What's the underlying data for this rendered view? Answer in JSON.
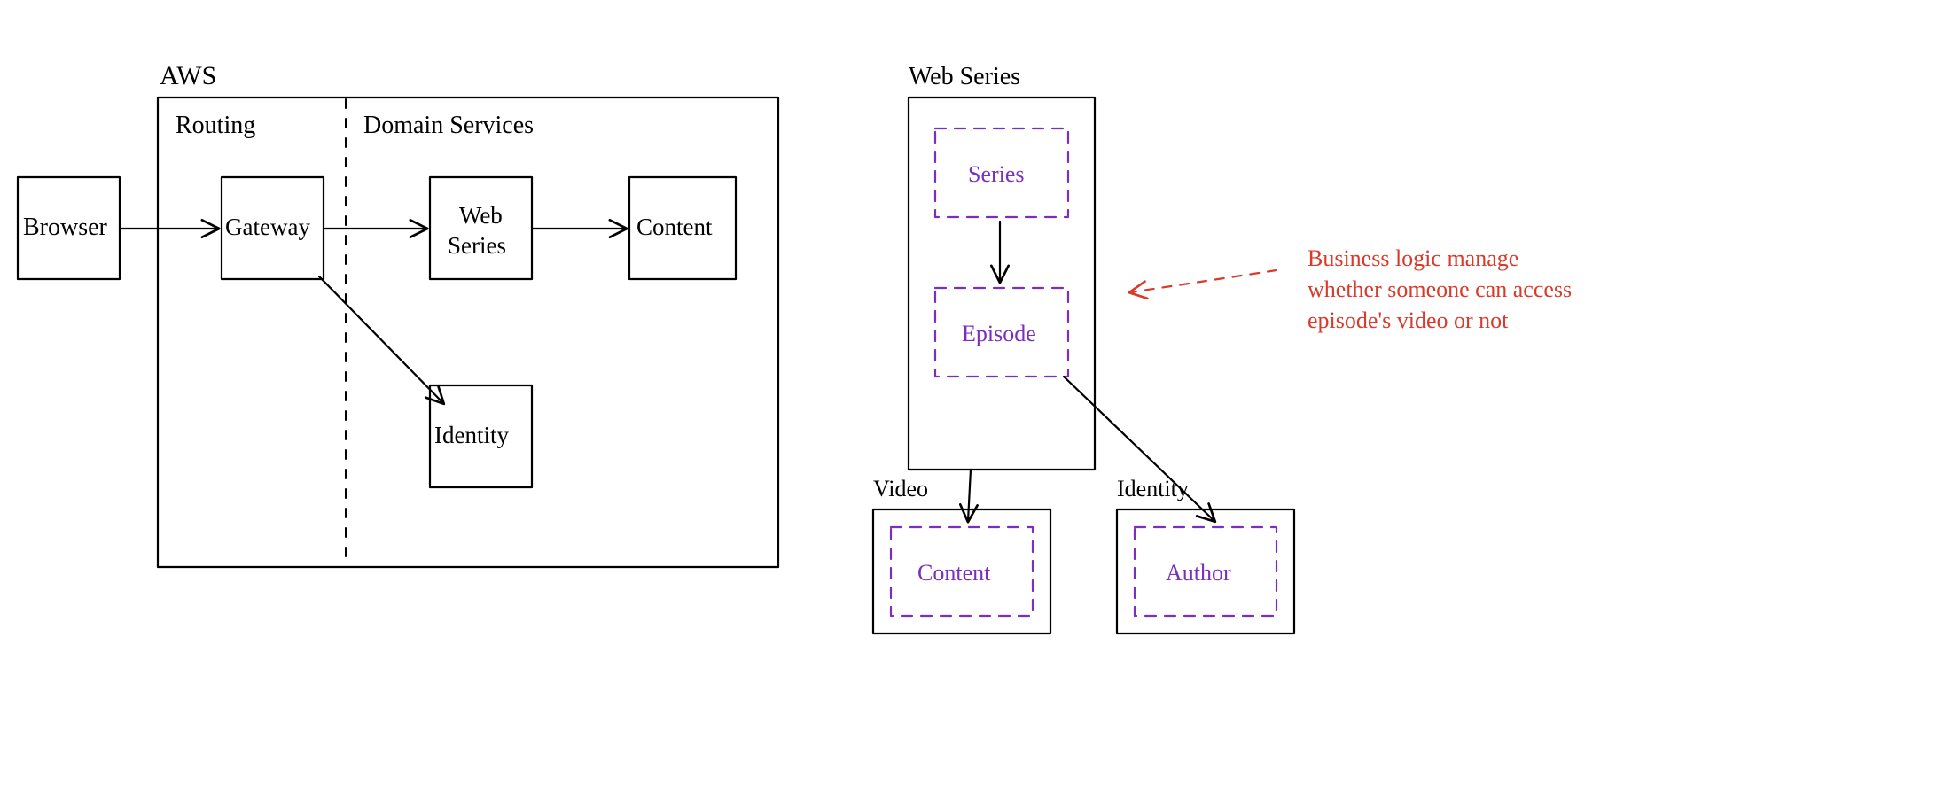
{
  "left": {
    "browser_label": "Browser",
    "aws_label": "AWS",
    "routing_label": "Routing",
    "domain_services_label": "Domain Services",
    "gateway_label": "Gateway",
    "web_series_line1": "Web",
    "web_series_line2": "Series",
    "content_label": "Content",
    "identity_label": "Identity"
  },
  "right": {
    "web_series_label": "Web Series",
    "series_label": "Series",
    "episode_label": "Episode",
    "video_label": "Video",
    "identity_label": "Identity",
    "content_label": "Content",
    "author_label": "Author",
    "note_line1": "Business logic manage",
    "note_line2": "whether someone can access",
    "note_line3": "episode's video or not"
  },
  "colors": {
    "purple": "#7b2fbf",
    "red": "#d93a2b",
    "black": "#000000"
  }
}
